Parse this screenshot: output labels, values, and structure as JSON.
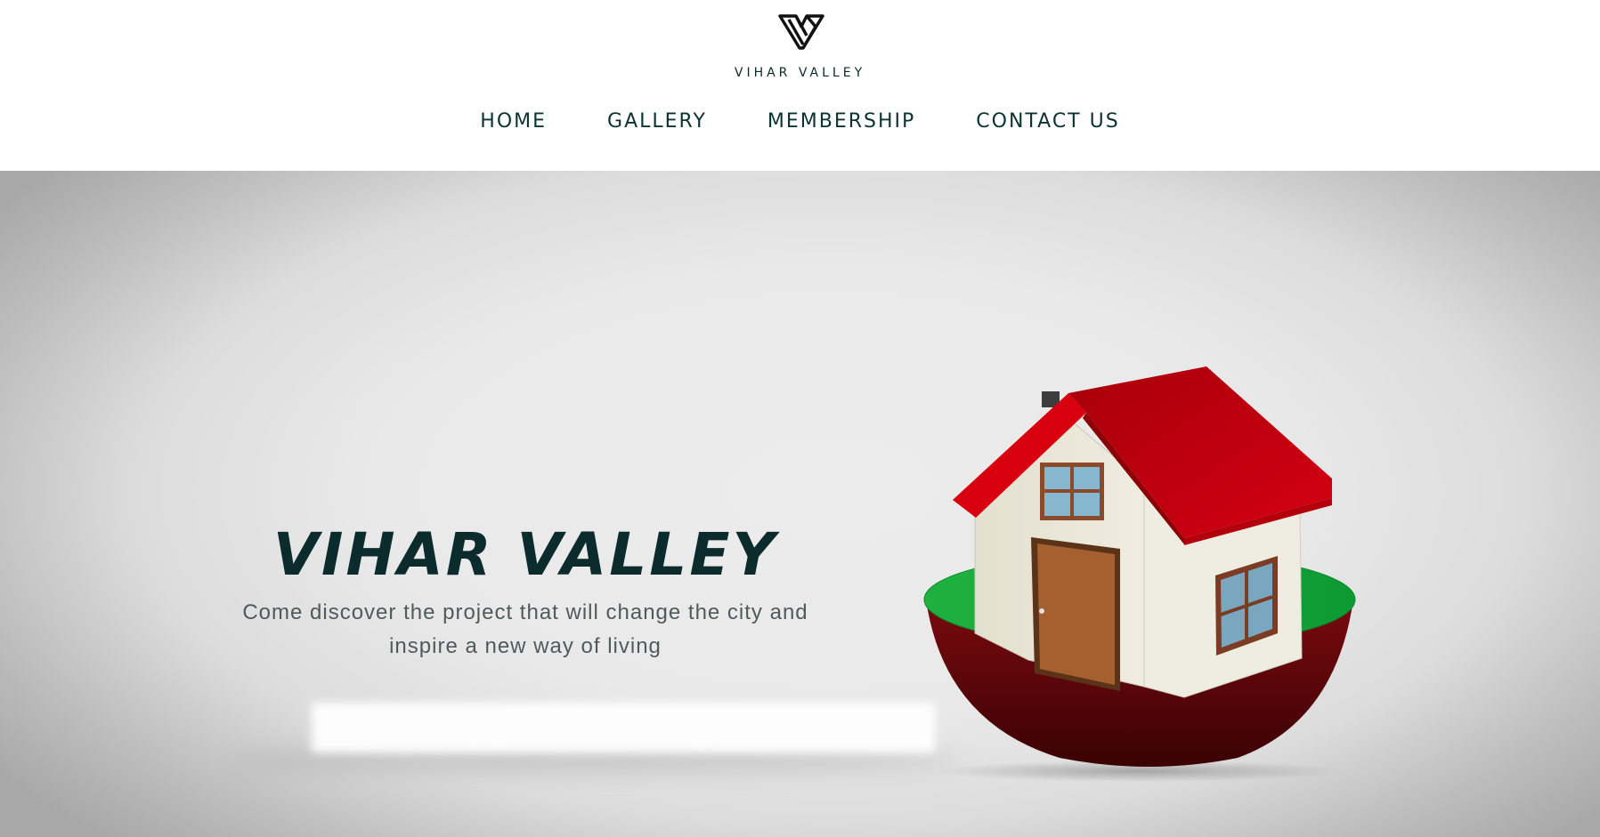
{
  "header": {
    "logo_icon": "v-monogram-logo-icon",
    "brand_name": "VIHAR VALLEY",
    "nav": [
      {
        "label": "HOME"
      },
      {
        "label": "GALLERY"
      },
      {
        "label": "MEMBERSHIP"
      },
      {
        "label": "CONTACT US"
      }
    ]
  },
  "hero": {
    "title": "VIHAR VALLEY",
    "subtitle_line1": "Come discover the project that will change the city and",
    "subtitle_line2": "inspire a new way of living",
    "image": "house-on-island-illustration"
  },
  "colors": {
    "primary_text": "#0c2b2c",
    "nav_text": "#0b3333",
    "subtitle_text": "#505a5a",
    "roof_red": "#d0000f",
    "grass_green": "#1aa33a",
    "soil_dark_red": "#5a0508",
    "door_brown": "#a65f2f"
  }
}
